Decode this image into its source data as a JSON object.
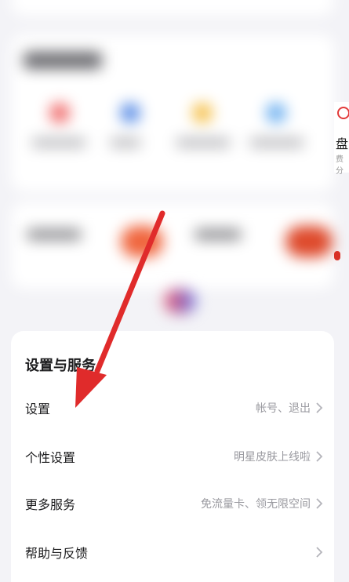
{
  "peek": {
    "label": "盘",
    "sub": "费分"
  },
  "settings": {
    "title": "设置与服务",
    "rows": [
      {
        "label": "设置",
        "value": "帐号、退出"
      },
      {
        "label": "个性设置",
        "value": "明星皮肤上线啦"
      },
      {
        "label": "更多服务",
        "value": "免流量卡、领无限空间"
      },
      {
        "label": "帮助与反馈",
        "value": ""
      }
    ]
  },
  "colors": {
    "accent_red": "#e02b2b",
    "chevron": "#b4b4ba",
    "page_bg": "#f3f3f7"
  },
  "icons": [
    "chevron-right-icon",
    "annotation-arrow-icon"
  ]
}
